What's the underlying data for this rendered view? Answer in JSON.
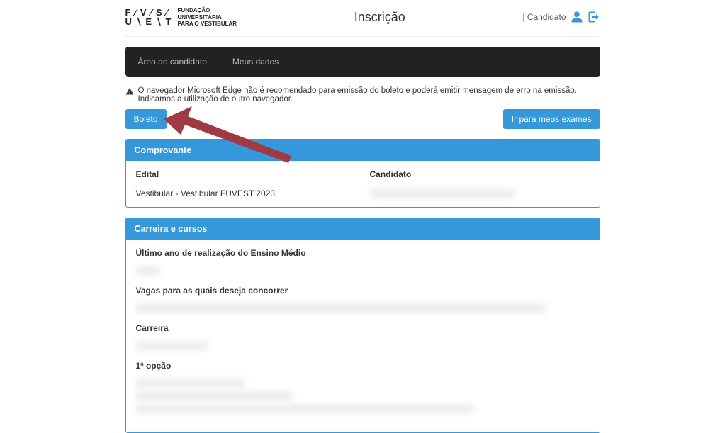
{
  "header": {
    "logo_mark_line1": "F ∕ V ∕ S ∕",
    "logo_mark_line2": "U ∖ E ∖ T",
    "logo_text_line1": "Fundação",
    "logo_text_line2": "Universitária",
    "logo_text_line3": "para o Vestibular",
    "title": "Inscrição",
    "user_label": "| Candidato"
  },
  "nav": {
    "item1": "Área do candidato",
    "item2": "Meus dados"
  },
  "alert": {
    "text": "O navegador Microsoft Edge não é recomendado para emissão do boleto e poderá emitir mensagem de erro na emissão. Indicamos a utilização de outro navegador."
  },
  "buttons": {
    "boleto": "Boleto",
    "exames": "Ir para meus exames"
  },
  "panel1": {
    "title": "Comprovante",
    "edital_label": "Edital",
    "edital_value": "Vestibular - Vestibular FUVEST 2023",
    "candidato_label": "Candidato",
    "candidato_value": "████████████████████████"
  },
  "panel2": {
    "title": "Carreira e cursos",
    "f1_label": "Último ano de realização do Ensino Médio",
    "f1_value": "████",
    "f2_label": "Vagas para as quais deseja concorrer",
    "f2_value": "████████████████████████████████████████████████████████████████████",
    "f3_label": "Carreira",
    "f3_value": "████████████",
    "f4_label": "1ª opção",
    "f4_v1": "██████████████████",
    "f4_v2": "██████████████████████████",
    "f4_v3": "████████████████████████████████████████████████████████"
  }
}
